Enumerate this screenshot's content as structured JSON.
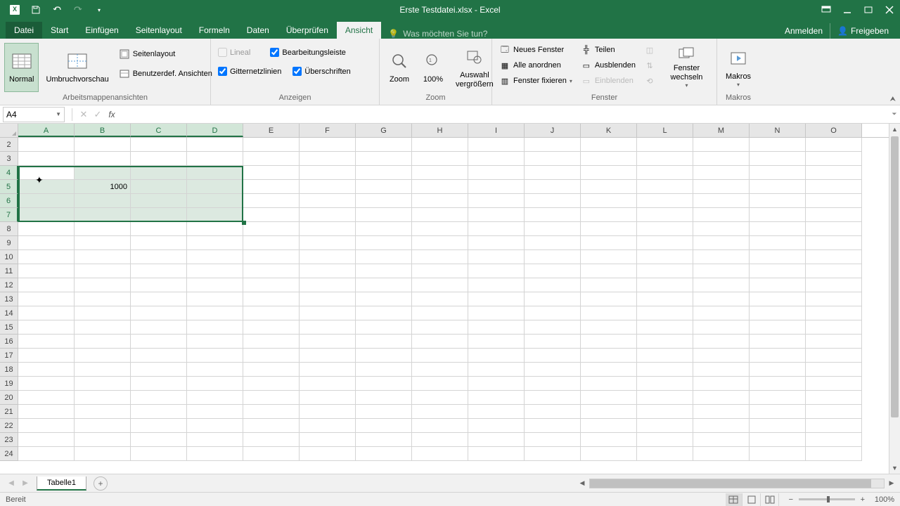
{
  "title": "Erste Testdatei.xlsx - Excel",
  "qat": {
    "save": "save",
    "undo": "undo",
    "redo": "redo"
  },
  "tabs": {
    "datei": "Datei",
    "start": "Start",
    "einfuegen": "Einfügen",
    "seitenlayout": "Seitenlayout",
    "formeln": "Formeln",
    "daten": "Daten",
    "ueberpruefen": "Überprüfen",
    "ansicht": "Ansicht",
    "tell_me": "Was möchten Sie tun?",
    "anmelden": "Anmelden",
    "freigeben": "Freigeben"
  },
  "ribbon": {
    "views_group": "Arbeitsmappenansichten",
    "normal": "Normal",
    "umbruch": "Umbruchvorschau",
    "seitenlayout": "Seitenlayout",
    "benutzerdef": "Benutzerdef. Ansichten",
    "anzeigen_group": "Anzeigen",
    "lineal": "Lineal",
    "bearbeitungsleiste": "Bearbeitungsleiste",
    "gitternetz": "Gitternetzlinien",
    "ueberschriften": "Überschriften",
    "zoom_group": "Zoom",
    "zoom": "Zoom",
    "hundred": "100%",
    "auswahl": "Auswahl vergrößern",
    "fenster_group": "Fenster",
    "neues_fenster": "Neues Fenster",
    "alle_anordnen": "Alle anordnen",
    "fenster_fixieren": "Fenster fixieren",
    "teilen": "Teilen",
    "ausblenden": "Ausblenden",
    "einblenden": "Einblenden",
    "fenster_wechseln": "Fenster wechseln",
    "makros_group": "Makros",
    "makros": "Makros"
  },
  "formula_bar": {
    "name_box": "A4",
    "formula": ""
  },
  "grid": {
    "columns": [
      "A",
      "B",
      "C",
      "D",
      "E",
      "F",
      "G",
      "H",
      "I",
      "J",
      "K",
      "L",
      "M",
      "N",
      "O"
    ],
    "rows": [
      "2",
      "3",
      "4",
      "5",
      "6",
      "7",
      "8",
      "9",
      "10",
      "11",
      "12",
      "13",
      "14",
      "15",
      "16",
      "17",
      "18",
      "19",
      "20",
      "21",
      "22",
      "23",
      "24"
    ],
    "selected_cols": [
      "A",
      "B",
      "C",
      "D"
    ],
    "selected_rows": [
      "4",
      "5",
      "6",
      "7"
    ],
    "active_cell": "A4",
    "cells": {
      "B5": "1000"
    }
  },
  "sheet": {
    "tab": "Tabelle1"
  },
  "status": {
    "ready": "Bereit",
    "zoom": "100%"
  }
}
